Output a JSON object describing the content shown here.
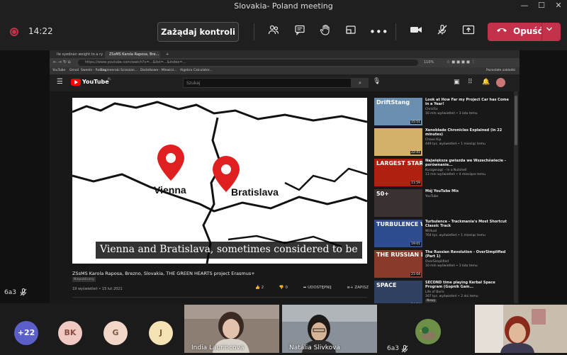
{
  "window": {
    "title": "Slovakia- Poland meeting",
    "minimize": "—",
    "maximize": "☐",
    "close": "✕"
  },
  "toolbar": {
    "timer": "14:22",
    "request_control_label": "Zażądaj kontroli",
    "leave_label": "Opuść"
  },
  "browser": {
    "tabs": [
      {
        "title": "Ile syednan weight to a ry t..."
      },
      {
        "title": "ZSsMS Karola Raposa, Bre..."
      }
    ],
    "url": "https://www.youtube.com/watch?v=...&list=...&index=...",
    "zoom": "110%",
    "bookmarks": [
      "YouTube",
      "Gmail",
      "Sweets - Roblox",
      "Engineeraki Sciezzan...",
      "Dodatkowe - Mlewicz...",
      "Algebra Calculator..."
    ],
    "other_bookmarks": "Pozostałe zakładki"
  },
  "youtube": {
    "brand": "YouTube",
    "brand_sup": "PL",
    "search_placeholder": "Szukaj",
    "map_labels": {
      "vienna": "Vienna",
      "bratislava": "Bratislava"
    },
    "caption": "Vienna and Bratislava, sometimes considered to be",
    "video_title": "ZSsMS Karola Raposa, Brezno, Slovakia, THE GREEN HEARTS project Erasmus+",
    "video_tag": "Niepubliczny",
    "video_meta": "19 wyświetleń • 15 lut 2021",
    "likes": "2",
    "dislikes": "0",
    "share": "UDOSTĘPNIJ",
    "save": "ZAPISZ",
    "sidebar": [
      {
        "thumb_text": "DriftStang",
        "duration": "15:51",
        "title": "Look at How Far my Project Car has Come in a Year!",
        "channel": "ChrisFix",
        "stats": "16 mln wyświetleń • 3 lata temu",
        "bg": "#6b8fb0"
      },
      {
        "thumb_text": "",
        "duration": "22:41",
        "title": "Xenoblade Chronicles Explained (in 22 minutes)",
        "channel": "Chase Kip",
        "stats": "449 tys. wyświetleń • 1 miesiąc temu",
        "bg": "#d4b06a"
      },
      {
        "thumb_text": "LARGEST STAR",
        "duration": "11:59",
        "title": "Największa gwiazda we Wszechświecie - porównanie...",
        "channel": "Kurzgesagt – In a Nutshell",
        "stats": "13 mln wyświetleń • 4 miesiące temu",
        "bg": "#b02010"
      },
      {
        "thumb_text": "50+",
        "duration": "",
        "title": "Mój YouTube Mix",
        "channel": "YouTube",
        "stats": "",
        "bg": "#3a3230"
      },
      {
        "thumb_text": "TURBULENCE WAS BROKEN",
        "duration": "19:01",
        "title": "Turbulence - Trackmania's Most Shortcut Classic Track",
        "channel": "Wirtual",
        "stats": "764 tys. wyświetleń • 1 miesiąc temu",
        "bg": "#2f4c8f"
      },
      {
        "thumb_text": "THE RUSSIAN REVOLUTION",
        "duration": "21:04",
        "title": "The Russian Revolution - OverSimplified (Part 1)",
        "channel": "OverSimplified",
        "stats": "10 mln wyświetleń • 3 lata temu",
        "bg": "#8a3a2a"
      },
      {
        "thumb_text": "SPACE",
        "duration": "14:04",
        "title": "SECOND time playing Kerbal Space Program (Gopnik Gam...",
        "channel": "Life of Boris",
        "stats": "167 tys. wyświetleń • 2 dni temu",
        "bg": "#304060",
        "badge": "Nowy"
      }
    ]
  },
  "presenter": {
    "label": "6a3"
  },
  "participants": {
    "overflow": "+22",
    "initials": [
      {
        "text": "BK",
        "color": "#f1c9c3",
        "fg": "#8a4b40"
      },
      {
        "text": "G",
        "color": "#f2d7c8",
        "fg": "#7a5a48"
      },
      {
        "text": "J",
        "color": "#f5e2b5",
        "fg": "#7a6330"
      }
    ],
    "tiles": [
      {
        "name": "India Laurincova",
        "bg": "#8e7f74"
      },
      {
        "name": "Natália Slivková",
        "bg": "#8a9098"
      }
    ],
    "self_label": "6a3"
  },
  "colors": {
    "leave": "#c4314b",
    "overflow": "#5b5fc7"
  }
}
